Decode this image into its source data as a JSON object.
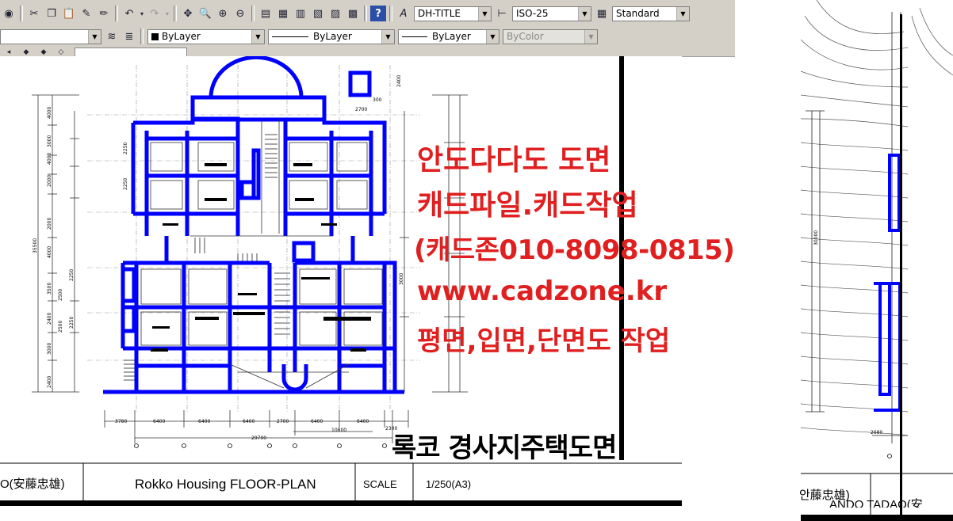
{
  "toolbar": {
    "text_style": "DH-TITLE",
    "dim_style": "ISO-25",
    "table_style": "Standard",
    "layer_color": "ByLayer",
    "linetype": "ByLayer",
    "lineweight": "ByLayer",
    "plot_style": "ByColor"
  },
  "drawing": {
    "dims_bottom": [
      "3780",
      "6400",
      "6400",
      "6400",
      "2700",
      "6400",
      "6400"
    ],
    "dim_total": "29700",
    "dim_sub": "10800",
    "dim_2300": "2300",
    "dims_top": [
      "2700",
      "300"
    ],
    "dim_top_vertical": "2400",
    "dims_left": [
      "4000",
      "3000",
      "4000",
      "2000",
      "2000",
      "4000",
      "3500",
      "2400",
      "3000",
      "2400"
    ],
    "dim_left_total": "35500",
    "dims_inner": [
      "2250",
      "2250",
      "2250",
      "2250",
      "2500",
      "2500"
    ],
    "dim_right": "3000"
  },
  "overlay": {
    "line1": "안도다다도 도면",
    "line2": "캐드파일.캐드작업",
    "line3": "(캐드존010-8098-0815)",
    "line4": "www.cadzone.kr",
    "line5": "평면,입면,단면도 작업"
  },
  "plan_title": "록코 경사지주택도면",
  "titleblock": {
    "architect": "O(安藤忠雄)",
    "drawing_name": "Rokko Housing FLOOR-PLAN",
    "scale_label": "SCALE",
    "scale_value": "1/250(A3)"
  },
  "right_view": {
    "titleblock_left": "안藤忠雄)",
    "titleblock_right": "ANDO TADAO(安",
    "dim_bottom": "2680",
    "dim_left": "30000"
  },
  "colors": {
    "toolbar_bg": "#d4d0c8",
    "plan_blue": "#0000ff",
    "overlay_red": "#e02020"
  }
}
